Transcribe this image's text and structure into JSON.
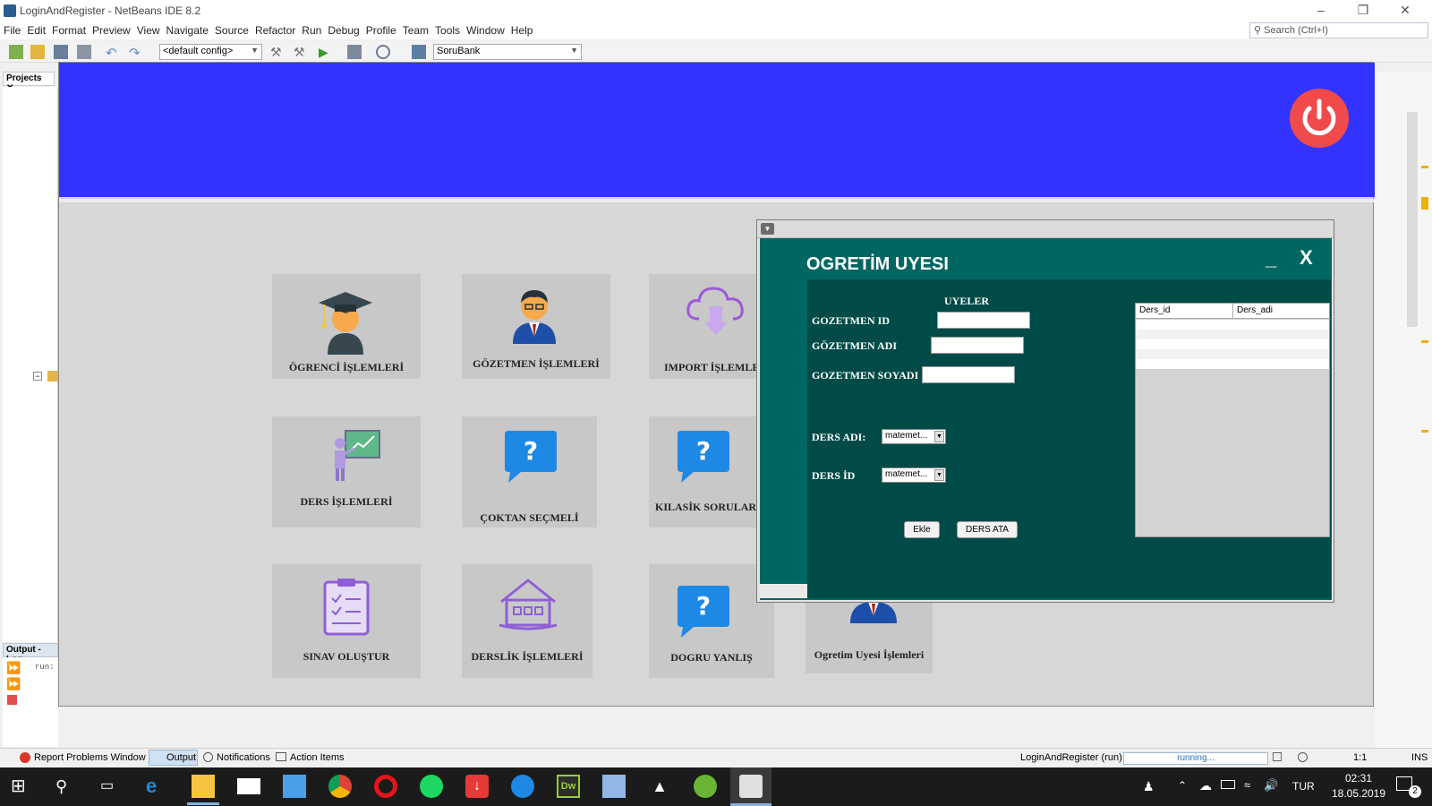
{
  "window": {
    "title": "LoginAndRegister - NetBeans IDE 8.2",
    "minimize": "–",
    "restore": "❐",
    "close": "✕"
  },
  "menu": [
    "File",
    "Edit",
    "Format",
    "Preview",
    "View",
    "Navigate",
    "Source",
    "Refactor",
    "Run",
    "Debug",
    "Profile",
    "Team",
    "Tools",
    "Window",
    "Help"
  ],
  "search": {
    "placeholder": "Search (Ctrl+I)"
  },
  "toolbar": {
    "config": "<default config>",
    "project": "SoruBank"
  },
  "panels": {
    "projects": "Projects",
    "output": "Output - Log",
    "output_text": "run:"
  },
  "tiles": [
    {
      "label": "ÖGRENCİ İŞLEMLERİ",
      "icon": "student-icon"
    },
    {
      "label": "GÖZETMEN İŞLEMLERİ",
      "icon": "supervisor-icon"
    },
    {
      "label": "IMPORT İŞLEMLE",
      "icon": "cloud-download-icon"
    },
    {
      "label": "DERS İŞLEMLERİ",
      "icon": "teacher-board-icon"
    },
    {
      "label": "ÇOKTAN SEÇMELİ",
      "icon": "question-bubble-icon"
    },
    {
      "label": "KILASİK SORULAR",
      "icon": "question-bubble-icon"
    },
    {
      "label": "SINAV OLUŞTUR",
      "icon": "clipboard-check-icon"
    },
    {
      "label": "DERSLİK İŞLEMLERİ",
      "icon": "classroom-icon"
    },
    {
      "label": "DOGRU YANLIŞ",
      "icon": "question-bubble-icon"
    },
    {
      "label": "Ogretim Uyesi İşlemleri",
      "icon": "lecturer-icon"
    }
  ],
  "dialog": {
    "title": "OGRETİM UYESI",
    "minimize": "_",
    "close": "X",
    "section": "UYELER",
    "fields": {
      "id_label": "GOZETMEN ID",
      "name_label": "GÖZETMEN ADI",
      "surname_label": "GOZETMEN SOYADI",
      "ders_adi_label": "DERS ADI:",
      "ders_id_label": "DERS İD",
      "ders_adi_value": "matemet...",
      "ders_id_value": "matemet..."
    },
    "buttons": {
      "add": "Ekle",
      "assign": "DERS ATA"
    },
    "table": {
      "columns": [
        "Ders_id",
        "Ders_adi"
      ]
    }
  },
  "status": {
    "report": "Report Problems Window",
    "output": "Output",
    "notifications": "Notifications",
    "actions": "Action Items",
    "run": "LoginAndRegister (run)",
    "progress": "running...",
    "position": "1:1",
    "mode": "INS"
  },
  "taskbar": {
    "lang": "TUR",
    "time": "02:31",
    "date": "18.05.2019",
    "notif_count": "2"
  },
  "colors": {
    "banner": "#3333ff",
    "dialog": "#006661",
    "form": "#004b47",
    "power": "#f04a4a"
  }
}
